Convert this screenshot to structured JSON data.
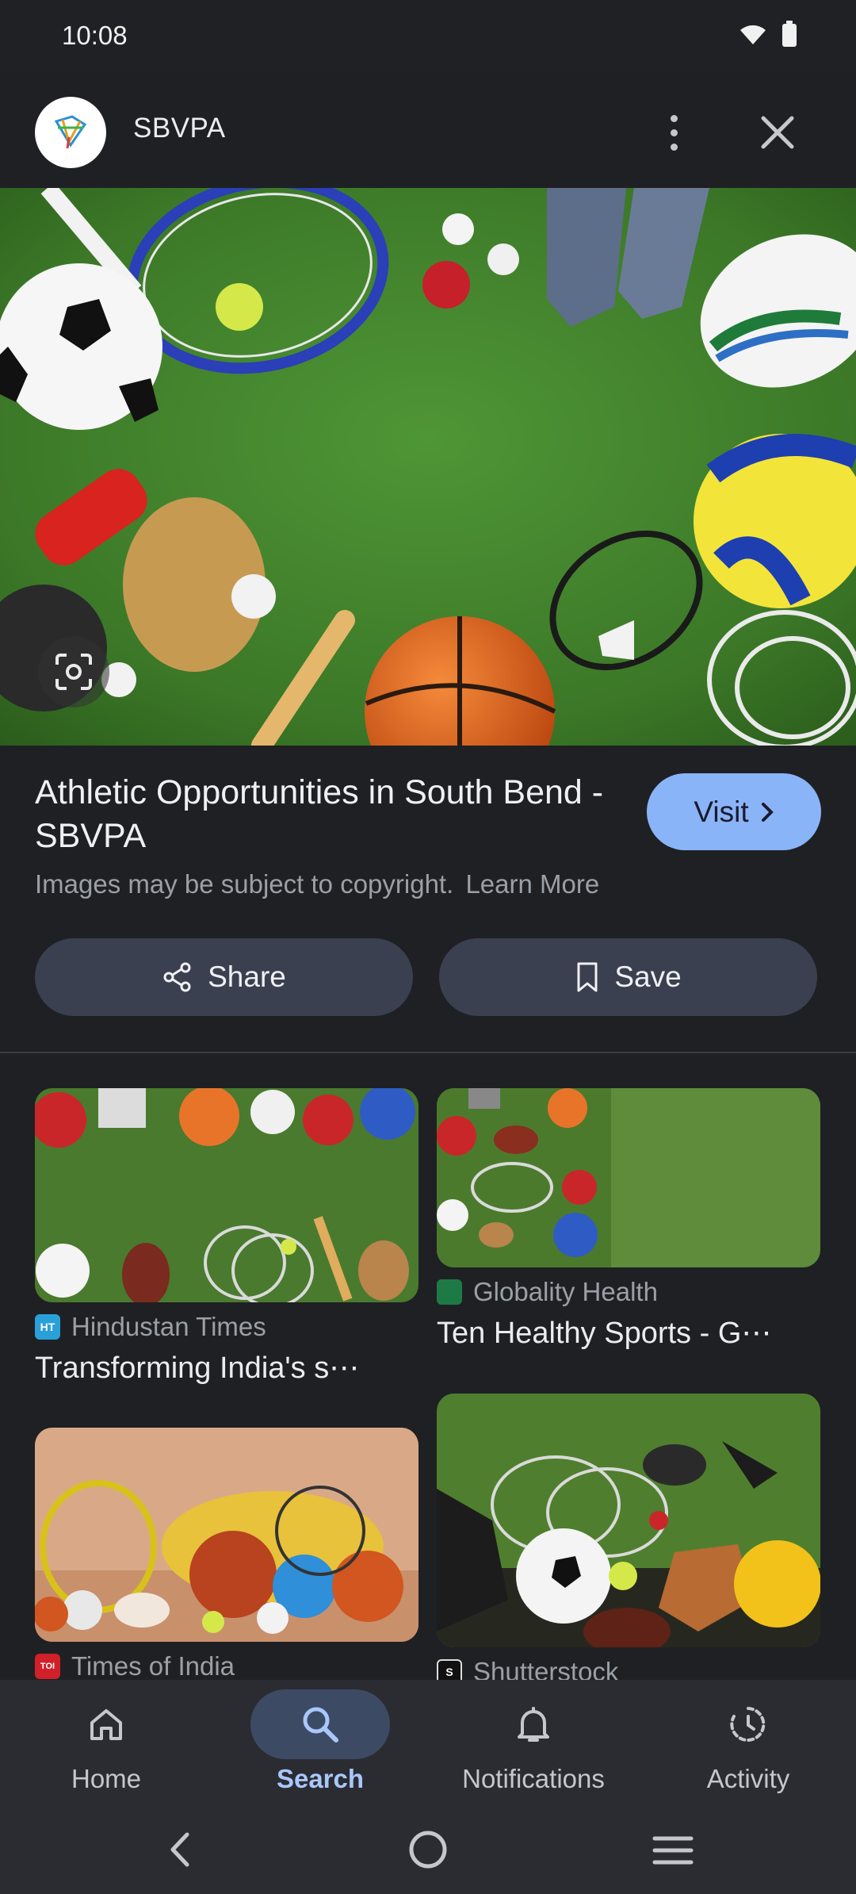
{
  "status": {
    "time": "10:08"
  },
  "header": {
    "site_name": "SBVPA"
  },
  "result": {
    "title": "Athletic Opportunities in South Bend - SBVPA",
    "visit_label": "Visit",
    "copyright_text": "Images may be subject to copyright.",
    "learn_more": "Learn More",
    "share_label": "Share",
    "save_label": "Save"
  },
  "related": [
    {
      "source": "Hindustan Times",
      "title": "Transforming India's s⋯"
    },
    {
      "source": "Globality Health",
      "title": "Ten Healthy Sports - G⋯"
    },
    {
      "source": "Times of India",
      "title": ""
    },
    {
      "source": "Shutterstock",
      "title": ""
    }
  ],
  "nav": {
    "items": [
      {
        "label": "Home",
        "icon": "home-icon"
      },
      {
        "label": "Search",
        "icon": "search-icon",
        "active": true
      },
      {
        "label": "Notifications",
        "icon": "bell-icon"
      },
      {
        "label": "Activity",
        "icon": "activity-icon"
      }
    ]
  },
  "colors": {
    "accent": "#8ab4f8",
    "active_nav": "#a8c7fa",
    "background": "#1f2024"
  }
}
